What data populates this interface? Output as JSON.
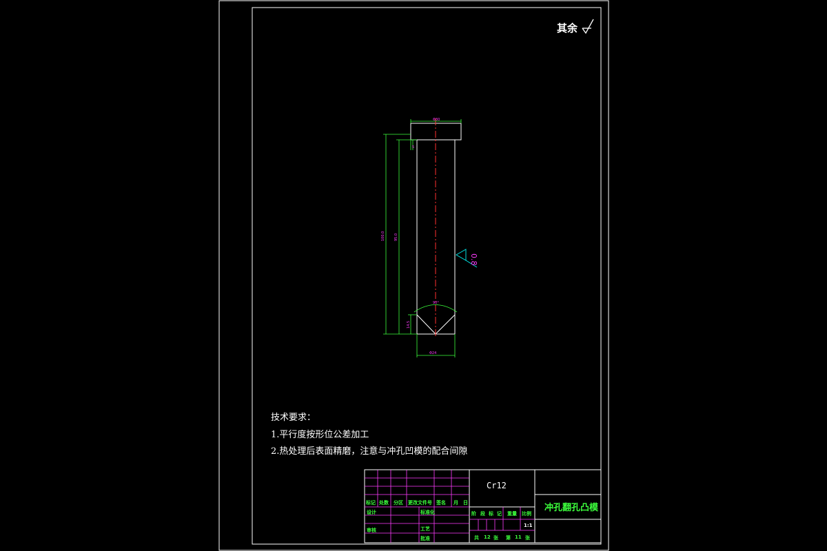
{
  "drawing": {
    "roughness_note": "其余",
    "surface_finish_value": "0.8",
    "dimensions": {
      "head_diameter": "Φ30",
      "head_height": "5",
      "total_length": "100.0",
      "shank_length": "95.0",
      "point_length": "14.5",
      "shank_diameter": "Φ24",
      "point_angle": "90°"
    }
  },
  "tech_requirements": {
    "title": "技术要求：",
    "items": [
      "1.平行度按形位公差加工",
      "2.热处理后表面精磨，注意与冲孔凹模的配合间隙"
    ]
  },
  "title_block": {
    "material": "Cr12",
    "part_name": "冲孔翻孔凸模",
    "header_cells": [
      "标记",
      "处数",
      "分区",
      "更改文件号",
      "签名",
      "月",
      "日"
    ],
    "design_label": "设计",
    "standardize_label": "标准化",
    "review_label": "审核",
    "process_label": "工艺",
    "approve_label": "批准",
    "stage_labels": [
      "阶",
      "段",
      "标",
      "记"
    ],
    "weight_label": "重量",
    "scale_label": "比例",
    "scale_value": "1:1",
    "total_sheets_prefix": "共",
    "total_sheets": "12",
    "sheet_suffix_1": "张",
    "sheet_no_prefix": "第",
    "sheet_no": "11",
    "sheet_suffix_2": "张"
  },
  "colors": {
    "border": "#ffffff",
    "dimension": "#3cff3c",
    "dimension_text": "#ff3cff",
    "centerline": "#ff3030",
    "surface_symbol": "#00e0e0",
    "table_lines": "#ff3cff"
  }
}
